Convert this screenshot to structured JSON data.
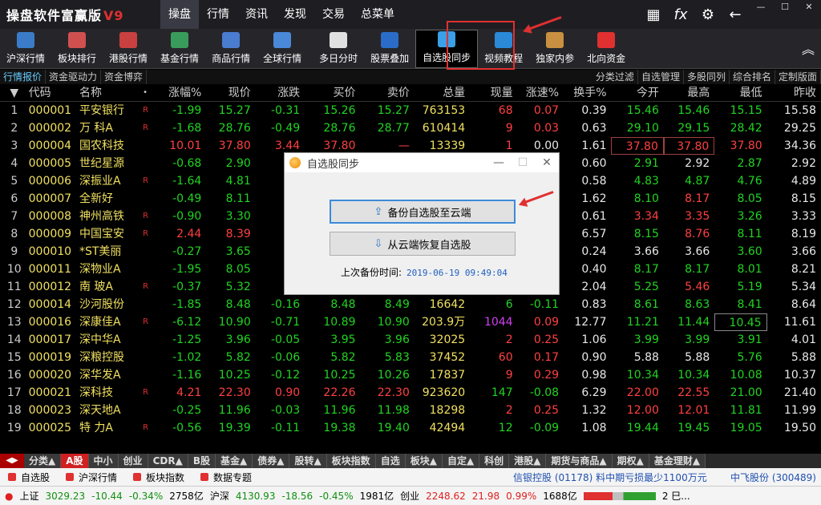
{
  "app": {
    "title": "操盘软件富赢版",
    "version": "V9"
  },
  "main_menu": [
    "操盘",
    "行情",
    "资讯",
    "发现",
    "交易",
    "总菜单"
  ],
  "toolbar": [
    {
      "label": "沪深行情",
      "color": "#3a7cc8"
    },
    {
      "label": "板块排行",
      "color": "#d05050"
    },
    {
      "label": "港股行情",
      "color": "#c84040"
    },
    {
      "label": "基金行情",
      "color": "#3a9c5c"
    },
    {
      "label": "商品行情",
      "color": "#4a7cd0"
    },
    {
      "label": "全球行情",
      "color": "#4a88d8"
    },
    {
      "label": "多日分时",
      "color": "#e0e0e0"
    },
    {
      "label": "股票叠加",
      "color": "#2a6cc8"
    },
    {
      "label": "自选股同步",
      "color": "#3aa0e8"
    },
    {
      "label": "视频教程",
      "color": "#2a8ad8"
    },
    {
      "label": "独家内参",
      "color": "#c89040"
    },
    {
      "label": "北向资金",
      "color": "#e03030"
    }
  ],
  "subbar_left": [
    "行情报价",
    "资金驱动力",
    "资金博弈"
  ],
  "subbar_right": [
    "分类过滤",
    "自选管理",
    "多股同列",
    "综合排名",
    "定制版面"
  ],
  "columns": [
    "",
    "代码",
    "名称",
    "•",
    "涨幅%",
    "现价",
    "涨跌",
    "买价",
    "卖价",
    "总量",
    "现量",
    "涨速%",
    "换手%",
    "今开",
    "最高",
    "最低",
    "昨收"
  ],
  "rows": [
    {
      "i": "1",
      "code": "000001",
      "name": "平安银行",
      "r": "R",
      "chg": "-1.99",
      "price": "15.27",
      "diff": "-0.31",
      "bid": "15.26",
      "ask": "15.27",
      "vol": "763153",
      "cur": "68",
      "spd": "0.07",
      "turn": "0.39",
      "open": "15.46",
      "high": "15.46",
      "low": "15.15",
      "prev": "15.58"
    },
    {
      "i": "2",
      "code": "000002",
      "name": "万 科A",
      "r": "R",
      "chg": "-1.68",
      "price": "28.76",
      "diff": "-0.49",
      "bid": "28.76",
      "ask": "28.77",
      "vol": "610414",
      "cur": "9",
      "spd": "0.03",
      "turn": "0.63",
      "open": "29.10",
      "high": "29.15",
      "low": "28.42",
      "prev": "29.25"
    },
    {
      "i": "3",
      "code": "000004",
      "name": "国农科技",
      "r": "",
      "chg": "10.01",
      "price": "37.80",
      "diff": "3.44",
      "bid": "37.80",
      "ask": "—",
      "vol": "13339",
      "cur": "1",
      "spd": "0.00",
      "turn": "1.61",
      "open": "37.80",
      "high": "37.80",
      "low": "37.80",
      "prev": "34.36"
    },
    {
      "i": "4",
      "code": "000005",
      "name": "世纪星源",
      "r": "",
      "chg": "-0.68",
      "price": "2.90",
      "diff": "",
      "bid": "",
      "ask": "",
      "vol": "",
      "cur": "",
      "spd": "",
      "turn": "0.60",
      "open": "2.91",
      "high": "2.92",
      "low": "2.87",
      "prev": "2.92"
    },
    {
      "i": "5",
      "code": "000006",
      "name": "深振业A",
      "r": "R",
      "chg": "-1.64",
      "price": "4.81",
      "diff": "",
      "bid": "",
      "ask": "",
      "vol": "",
      "cur": "",
      "spd": "",
      "turn": "0.58",
      "open": "4.83",
      "high": "4.87",
      "low": "4.76",
      "prev": "4.89"
    },
    {
      "i": "6",
      "code": "000007",
      "name": "全新好",
      "r": "",
      "chg": "-0.49",
      "price": "8.11",
      "diff": "",
      "bid": "",
      "ask": "",
      "vol": "",
      "cur": "",
      "spd": "",
      "turn": "1.62",
      "open": "8.10",
      "high": "8.17",
      "low": "8.05",
      "prev": "8.15"
    },
    {
      "i": "7",
      "code": "000008",
      "name": "神州高铁",
      "r": "R",
      "chg": "-0.90",
      "price": "3.30",
      "diff": "",
      "bid": "",
      "ask": "",
      "vol": "",
      "cur": "",
      "spd": "",
      "turn": "0.61",
      "open": "3.34",
      "high": "3.35",
      "low": "3.26",
      "prev": "3.33"
    },
    {
      "i": "8",
      "code": "000009",
      "name": "中国宝安",
      "r": "R",
      "chg": "2.44",
      "price": "8.39",
      "diff": "",
      "bid": "",
      "ask": "",
      "vol": "",
      "cur": "",
      "spd": "",
      "turn": "6.57",
      "open": "8.15",
      "high": "8.76",
      "low": "8.11",
      "prev": "8.19"
    },
    {
      "i": "9",
      "code": "000010",
      "name": "*ST美丽",
      "r": "",
      "chg": "-0.27",
      "price": "3.65",
      "diff": "",
      "bid": "",
      "ask": "",
      "vol": "",
      "cur": "",
      "spd": "",
      "turn": "0.24",
      "open": "3.66",
      "high": "3.66",
      "low": "3.60",
      "prev": "3.66"
    },
    {
      "i": "10",
      "code": "000011",
      "name": "深物业A",
      "r": "",
      "chg": "-1.95",
      "price": "8.05",
      "diff": "",
      "bid": "",
      "ask": "",
      "vol": "",
      "cur": "",
      "spd": "",
      "turn": "0.40",
      "open": "8.17",
      "high": "8.17",
      "low": "8.01",
      "prev": "8.21"
    },
    {
      "i": "11",
      "code": "000012",
      "name": "南 玻A",
      "r": "R",
      "chg": "-0.37",
      "price": "5.32",
      "diff": "",
      "bid": "",
      "ask": "",
      "vol": "",
      "cur": "",
      "spd": "",
      "turn": "2.04",
      "open": "5.25",
      "high": "5.46",
      "low": "5.19",
      "prev": "5.34"
    },
    {
      "i": "12",
      "code": "000014",
      "name": "沙河股份",
      "r": "",
      "chg": "-1.85",
      "price": "8.48",
      "diff": "-0.16",
      "bid": "8.48",
      "ask": "8.49",
      "vol": "16642",
      "cur": "6",
      "spd": "-0.11",
      "turn": "0.83",
      "open": "8.61",
      "high": "8.63",
      "low": "8.41",
      "prev": "8.64"
    },
    {
      "i": "13",
      "code": "000016",
      "name": "深康佳A",
      "r": "R",
      "chg": "-6.12",
      "price": "10.90",
      "diff": "-0.71",
      "bid": "10.89",
      "ask": "10.90",
      "vol": "203.9万",
      "cur": "1044",
      "spd": "0.09",
      "turn": "12.77",
      "open": "11.21",
      "high": "11.44",
      "low": "10.45",
      "prev": "11.61"
    },
    {
      "i": "14",
      "code": "000017",
      "name": "深中华A",
      "r": "",
      "chg": "-1.25",
      "price": "3.96",
      "diff": "-0.05",
      "bid": "3.95",
      "ask": "3.96",
      "vol": "32025",
      "cur": "2",
      "spd": "0.25",
      "turn": "1.06",
      "open": "3.99",
      "high": "3.99",
      "low": "3.91",
      "prev": "4.01"
    },
    {
      "i": "15",
      "code": "000019",
      "name": "深粮控股",
      "r": "",
      "chg": "-1.02",
      "price": "5.82",
      "diff": "-0.06",
      "bid": "5.82",
      "ask": "5.83",
      "vol": "37452",
      "cur": "60",
      "spd": "0.17",
      "turn": "0.90",
      "open": "5.88",
      "high": "5.88",
      "low": "5.76",
      "prev": "5.88"
    },
    {
      "i": "16",
      "code": "000020",
      "name": "深华发A",
      "r": "",
      "chg": "-1.16",
      "price": "10.25",
      "diff": "-0.12",
      "bid": "10.25",
      "ask": "10.26",
      "vol": "17837",
      "cur": "9",
      "spd": "0.29",
      "turn": "0.98",
      "open": "10.34",
      "high": "10.34",
      "low": "10.08",
      "prev": "10.37"
    },
    {
      "i": "17",
      "code": "000021",
      "name": "深科技",
      "r": "R",
      "chg": "4.21",
      "price": "22.30",
      "diff": "0.90",
      "bid": "22.26",
      "ask": "22.30",
      "vol": "923620",
      "cur": "147",
      "spd": "-0.08",
      "turn": "6.29",
      "open": "22.00",
      "high": "22.55",
      "low": "21.00",
      "prev": "21.40"
    },
    {
      "i": "18",
      "code": "000023",
      "name": "深天地A",
      "r": "",
      "chg": "-0.25",
      "price": "11.96",
      "diff": "-0.03",
      "bid": "11.96",
      "ask": "11.98",
      "vol": "18298",
      "cur": "2",
      "spd": "0.25",
      "turn": "1.32",
      "open": "12.00",
      "high": "12.01",
      "low": "11.81",
      "prev": "11.99"
    },
    {
      "i": "19",
      "code": "000025",
      "name": "特 力A",
      "r": "R",
      "chg": "-0.56",
      "price": "19.39",
      "diff": "-0.11",
      "bid": "19.38",
      "ask": "19.40",
      "vol": "42494",
      "cur": "12",
      "spd": "-0.09",
      "turn": "1.08",
      "open": "19.44",
      "high": "19.45",
      "low": "19.05",
      "prev": "19.50"
    }
  ],
  "dialog": {
    "title": "自选股同步",
    "backup_btn": "备份自选股至云端",
    "restore_btn": "从云端恢复自选股",
    "time_label": "上次备份时间:",
    "time_value": "2019-06-19 09:49:04"
  },
  "tabs": [
    "分类▲",
    "A股",
    "中小",
    "创业",
    "CDR▲",
    "B股",
    "基金▲",
    "债券▲",
    "股转▲",
    "板块指数",
    "自选",
    "板块▲",
    "自定▲",
    "科创",
    "港股▲",
    "期货与商品▲",
    "期权▲",
    "基金理财▲"
  ],
  "status1": {
    "items": [
      "自选股",
      "沪深行情",
      "板块指数",
      "数据专题"
    ],
    "marquee": "信银控股 (01178) 料中期亏损最少1100万元",
    "right": "中飞股份 (300489)"
  },
  "status2": {
    "sh_label": "上证",
    "sh_val": "3029.23",
    "sh_diff": "-10.44",
    "sh_pct": "-0.34%",
    "sh_amt": "2758亿",
    "hs_label": "沪深",
    "hs_val": "4130.93",
    "hs_diff": "-18.56",
    "hs_pct": "-0.45%",
    "hs_amt": "1981亿",
    "cy_label": "创业",
    "cy_val": "2248.62",
    "cy_diff": "21.98",
    "cy_pct": "0.99%",
    "cy_amt": "1688亿",
    "tail": "2 巳..."
  }
}
